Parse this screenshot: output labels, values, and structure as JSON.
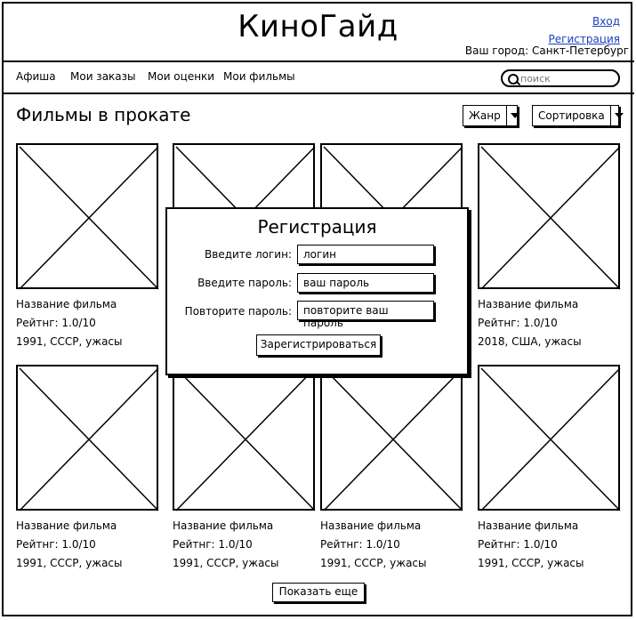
{
  "header": {
    "logo": "КиноГайд",
    "login_link": "Вход",
    "register_link": "Регистрация",
    "city_label": "Ваш город: Санкт-Петербург"
  },
  "nav": {
    "items": [
      "Афиша",
      "Мои заказы",
      "Мои оценки",
      "Мои фильмы"
    ],
    "search_placeholder": "поиск"
  },
  "main": {
    "title": "Фильмы в прокате",
    "genre_dropdown": "Жанр",
    "sort_dropdown": "Сортировка",
    "show_more": "Показать еще"
  },
  "movies": [
    {
      "name": "Название фильма",
      "rating": "Рейтнг: 1.0/10",
      "info": "1991, СССР, ужасы"
    },
    {
      "name": "",
      "rating": "",
      "info": ""
    },
    {
      "name": "",
      "rating": "",
      "info": ""
    },
    {
      "name": "Название фильма",
      "rating": "Рейтнг: 1.0/10",
      "info": "2018, США, ужасы"
    },
    {
      "name": "Название фильма",
      "rating": "Рейтнг: 1.0/10",
      "info": "1991, СССР, ужасы"
    },
    {
      "name": "Название фильма",
      "rating": "Рейтнг: 1.0/10",
      "info": "1991, СССР, ужасы"
    },
    {
      "name": "Название фильма",
      "rating": "Рейтнг: 1.0/10",
      "info": "1991, СССР, ужасы"
    },
    {
      "name": "Название фильма",
      "rating": "Рейтнг: 1.0/10",
      "info": "1991, СССР, ужасы"
    }
  ],
  "modal": {
    "title": "Регистрация",
    "login_label": "Введите логин:",
    "login_value": "логин",
    "password_label": "Введите пароль:",
    "password_value": "ваш пароль",
    "repeat_label": "Повторите пароль:",
    "repeat_value": "повторите ваш пароль",
    "submit": "Зарегистрироваться"
  }
}
